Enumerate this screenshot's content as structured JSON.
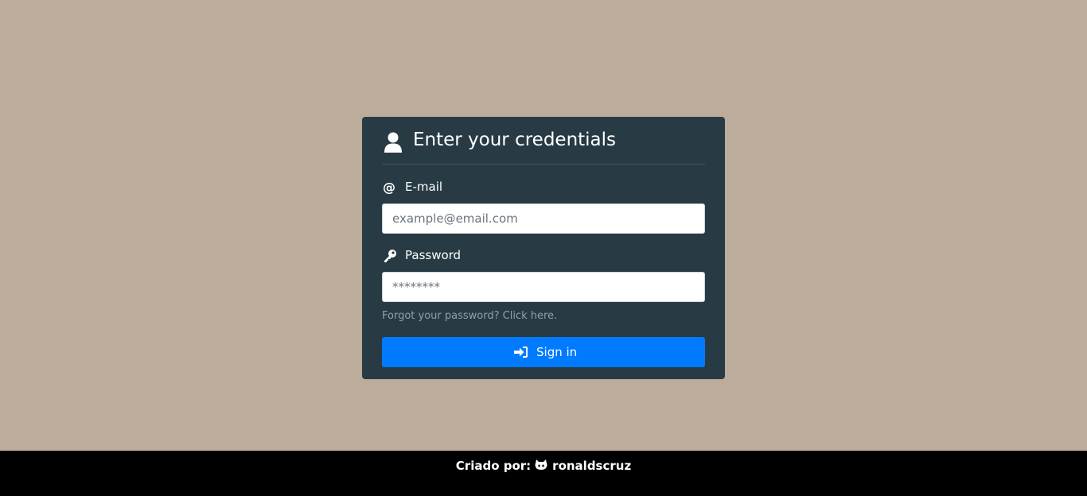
{
  "login": {
    "title": "Enter your credentials",
    "email": {
      "label": "E-mail",
      "placeholder": "example@email.com",
      "value": ""
    },
    "password": {
      "label": "Password",
      "placeholder": "********",
      "value": ""
    },
    "forgot_link": "Forgot your password? Click here.",
    "signin_label": "Sign in"
  },
  "footer": {
    "prefix": "Criado por:",
    "author": "ronaldscruz"
  },
  "icons": {
    "header": "user-icon",
    "email": "at-icon",
    "password": "key-icon",
    "signin": "sign-in-icon",
    "footer": "github-icon"
  },
  "colors": {
    "background": "#bcac9b",
    "card": "#283b45",
    "primary_button": "#007bff",
    "footer": "#000000",
    "link": "#8fa0a8"
  }
}
